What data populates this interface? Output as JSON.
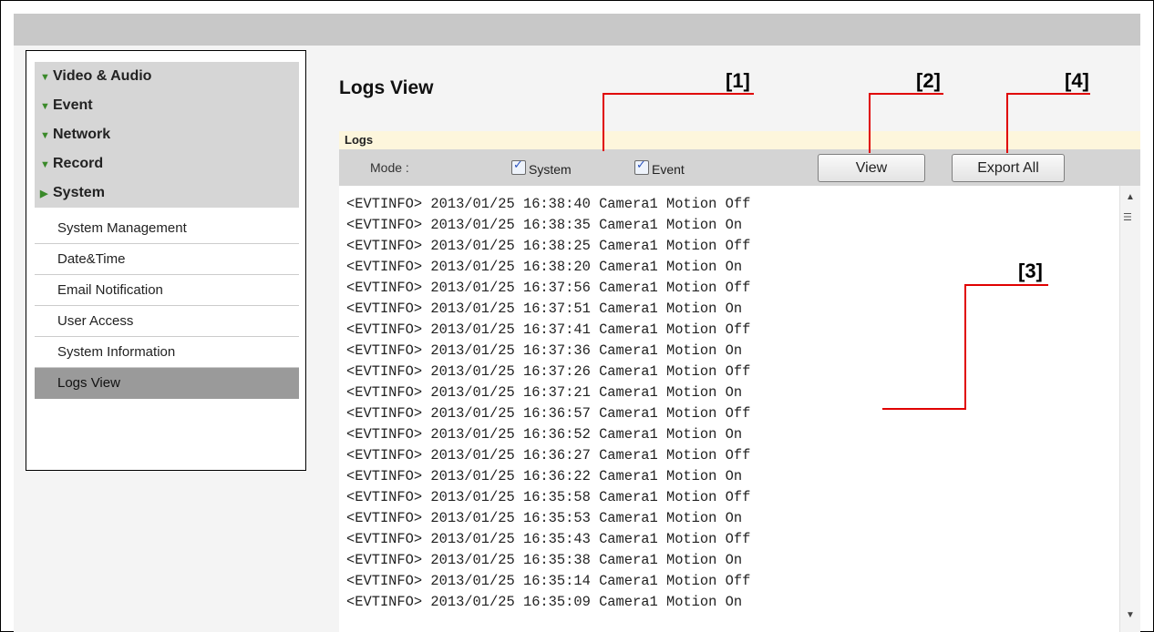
{
  "menu": [
    {
      "label": "Video & Audio",
      "icon": "caret-down-icon"
    },
    {
      "label": "Event",
      "icon": "caret-down-icon"
    },
    {
      "label": "Network",
      "icon": "caret-down-icon"
    },
    {
      "label": "Record",
      "icon": "caret-down-icon"
    },
    {
      "label": "System",
      "icon": "caret-right-icon"
    }
  ],
  "submenu": [
    {
      "label": "System Management"
    },
    {
      "label": "Date&Time"
    },
    {
      "label": "Email Notification"
    },
    {
      "label": "User Access"
    },
    {
      "label": "System Information"
    },
    {
      "label": "Logs View",
      "active": true
    }
  ],
  "page": {
    "title": "Logs View",
    "section": "Logs",
    "mode_label": "Mode :",
    "checkboxes": [
      {
        "label": "System",
        "checked": true
      },
      {
        "label": "Event",
        "checked": true
      }
    ],
    "view_button": "View",
    "export_button": "Export All"
  },
  "logs": [
    "<EVTINFO> 2013/01/25 16:38:40 Camera1 Motion Off",
    "<EVTINFO> 2013/01/25 16:38:35 Camera1 Motion On",
    "<EVTINFO> 2013/01/25 16:38:25 Camera1 Motion Off",
    "<EVTINFO> 2013/01/25 16:38:20 Camera1 Motion On",
    "<EVTINFO> 2013/01/25 16:37:56 Camera1 Motion Off",
    "<EVTINFO> 2013/01/25 16:37:51 Camera1 Motion On",
    "<EVTINFO> 2013/01/25 16:37:41 Camera1 Motion Off",
    "<EVTINFO> 2013/01/25 16:37:36 Camera1 Motion On",
    "<EVTINFO> 2013/01/25 16:37:26 Camera1 Motion Off",
    "<EVTINFO> 2013/01/25 16:37:21 Camera1 Motion On",
    "<EVTINFO> 2013/01/25 16:36:57 Camera1 Motion Off",
    "<EVTINFO> 2013/01/25 16:36:52 Camera1 Motion On",
    "<EVTINFO> 2013/01/25 16:36:27 Camera1 Motion Off",
    "<EVTINFO> 2013/01/25 16:36:22 Camera1 Motion On",
    "<EVTINFO> 2013/01/25 16:35:58 Camera1 Motion Off",
    "<EVTINFO> 2013/01/25 16:35:53 Camera1 Motion On",
    "<EVTINFO> 2013/01/25 16:35:43 Camera1 Motion Off",
    "<EVTINFO> 2013/01/25 16:35:38 Camera1 Motion On",
    "<EVTINFO> 2013/01/25 16:35:14 Camera1 Motion Off",
    "<EVTINFO> 2013/01/25 16:35:09 Camera1 Motion On"
  ],
  "callouts": [
    "[1]",
    "[2]",
    "[3]",
    "[4]"
  ],
  "colors": {
    "accent_caret": "#3a8a2a",
    "callout_line": "#e00000",
    "checkbox_check": "#2a52be"
  }
}
